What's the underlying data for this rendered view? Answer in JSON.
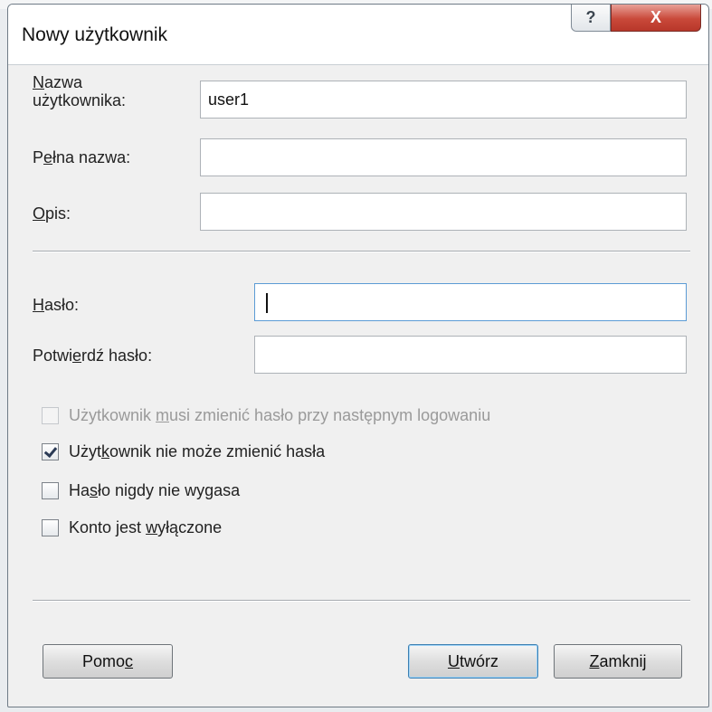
{
  "window": {
    "title": "Nowy użytkownik",
    "help_glyph": "?",
    "close_glyph": "X"
  },
  "form": {
    "username": {
      "label_acc": "N",
      "label_rest": "azwa",
      "label_line2": "użytkownika:",
      "value": "user1"
    },
    "fullname": {
      "label_pre": "P",
      "label_acc": "e",
      "label_rest": "łna nazwa:",
      "value": ""
    },
    "description": {
      "label_acc": "O",
      "label_rest": "pis:",
      "value": ""
    },
    "password": {
      "label_acc": "H",
      "label_rest": "asło:",
      "value": ""
    },
    "confirm": {
      "label_pre": "Potwi",
      "label_acc": "e",
      "label_rest": "rdź hasło:",
      "value": ""
    }
  },
  "checkboxes": [
    {
      "pre": "Użytkownik ",
      "acc": "m",
      "post": "usi zmienić hasło przy następnym logowaniu",
      "checked": false,
      "disabled": true
    },
    {
      "pre": "Użyt",
      "acc": "k",
      "post": "ownik nie może zmienić hasła",
      "checked": true,
      "disabled": false
    },
    {
      "pre": "Ha",
      "acc": "s",
      "post": "ło nigdy nie wygasa",
      "checked": false,
      "disabled": false
    },
    {
      "pre": "Konto jest ",
      "acc": "w",
      "post": "yłączone",
      "checked": false,
      "disabled": false
    }
  ],
  "buttons": {
    "help": {
      "pre": "Pomo",
      "acc": "c",
      "post": ""
    },
    "create": {
      "pre": "",
      "acc": "U",
      "post": "twórz"
    },
    "close": {
      "pre": "",
      "acc": "Z",
      "post": "amknij"
    }
  }
}
